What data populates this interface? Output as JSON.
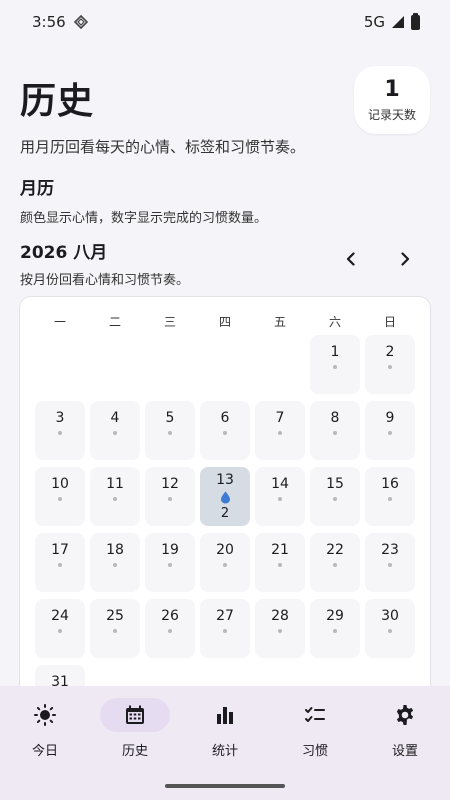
{
  "status": {
    "time": "3:56",
    "network": "5G"
  },
  "header": {
    "title": "历史",
    "subtitle": "用月历回看每天的心情、标签和习惯节奏。",
    "record_count": "1",
    "record_label": "记录天数"
  },
  "calendar_section": {
    "title": "月历",
    "description": "颜色显示心情，数字显示完成的习惯数量。"
  },
  "month": {
    "title": "2026 八月",
    "description": "按月份回看心情和习惯节奏。"
  },
  "weekdays": [
    "一",
    "二",
    "三",
    "四",
    "五",
    "六",
    "日"
  ],
  "days": [
    "",
    "",
    "",
    "",
    "",
    "1",
    "2",
    "3",
    "4",
    "5",
    "6",
    "7",
    "8",
    "9",
    "10",
    "11",
    "12",
    "13",
    "14",
    "15",
    "16",
    "17",
    "18",
    "19",
    "20",
    "21",
    "22",
    "23",
    "24",
    "25",
    "26",
    "27",
    "28",
    "29",
    "30",
    "31"
  ],
  "active_day": {
    "day": "13",
    "habit_count": "2",
    "mood_icon": "water-drop-icon"
  },
  "bottom_nav": {
    "items": [
      {
        "label": "今日",
        "icon": "sun-icon"
      },
      {
        "label": "历史",
        "icon": "calendar-icon"
      },
      {
        "label": "统计",
        "icon": "bar-chart-icon"
      },
      {
        "label": "习惯",
        "icon": "checklist-icon"
      },
      {
        "label": "设置",
        "icon": "gear-icon"
      }
    ],
    "selected": "历史"
  },
  "colors": {
    "active_day_bg": "#d6dce3",
    "nav_bg": "#efe9f4",
    "nav_selected": "#e6dcf2",
    "drop_blue": "#3d7bd4"
  }
}
